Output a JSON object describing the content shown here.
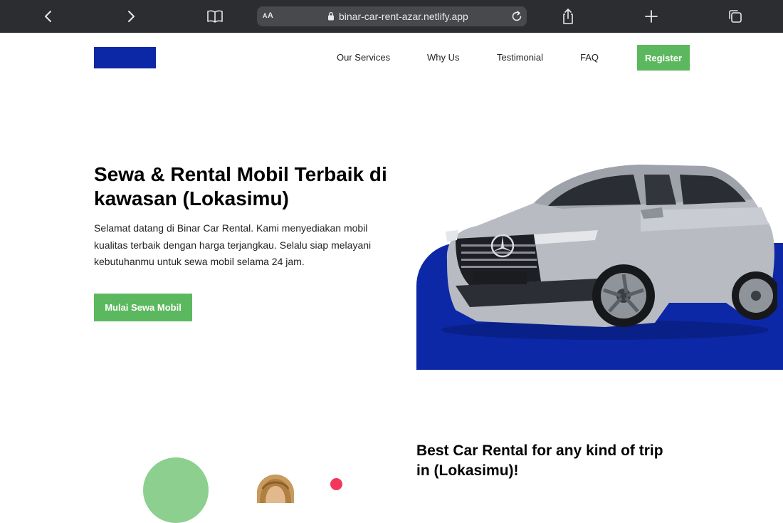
{
  "browser": {
    "url": "binar-car-rent-azar.netlify.app",
    "aa_label": "AA"
  },
  "navbar": {
    "links": [
      "Our Services",
      "Why Us",
      "Testimonial",
      "FAQ"
    ],
    "register_label": "Register",
    "logo_color": "#0d28a6"
  },
  "hero": {
    "title": "Sewa & Rental Mobil Terbaik di kawasan (Lokasimu)",
    "description": "Selamat datang di Binar Car Rental. Kami menyediakan mobil kualitas terbaik dengan harga terjangkau. Selalu siap melayani kebutuhanmu untuk sewa mobil selama 24 jam.",
    "cta_label": "Mulai Sewa Mobil"
  },
  "second_section": {
    "title": "Best Car Rental for any kind of trip in (Lokasimu)!"
  },
  "colors": {
    "brand_blue": "#0d28a6",
    "accent_green": "#5cb85f",
    "light_green": "#8ccf8f",
    "red_accent": "#f2375b",
    "toolbar": "#2b2d30"
  }
}
